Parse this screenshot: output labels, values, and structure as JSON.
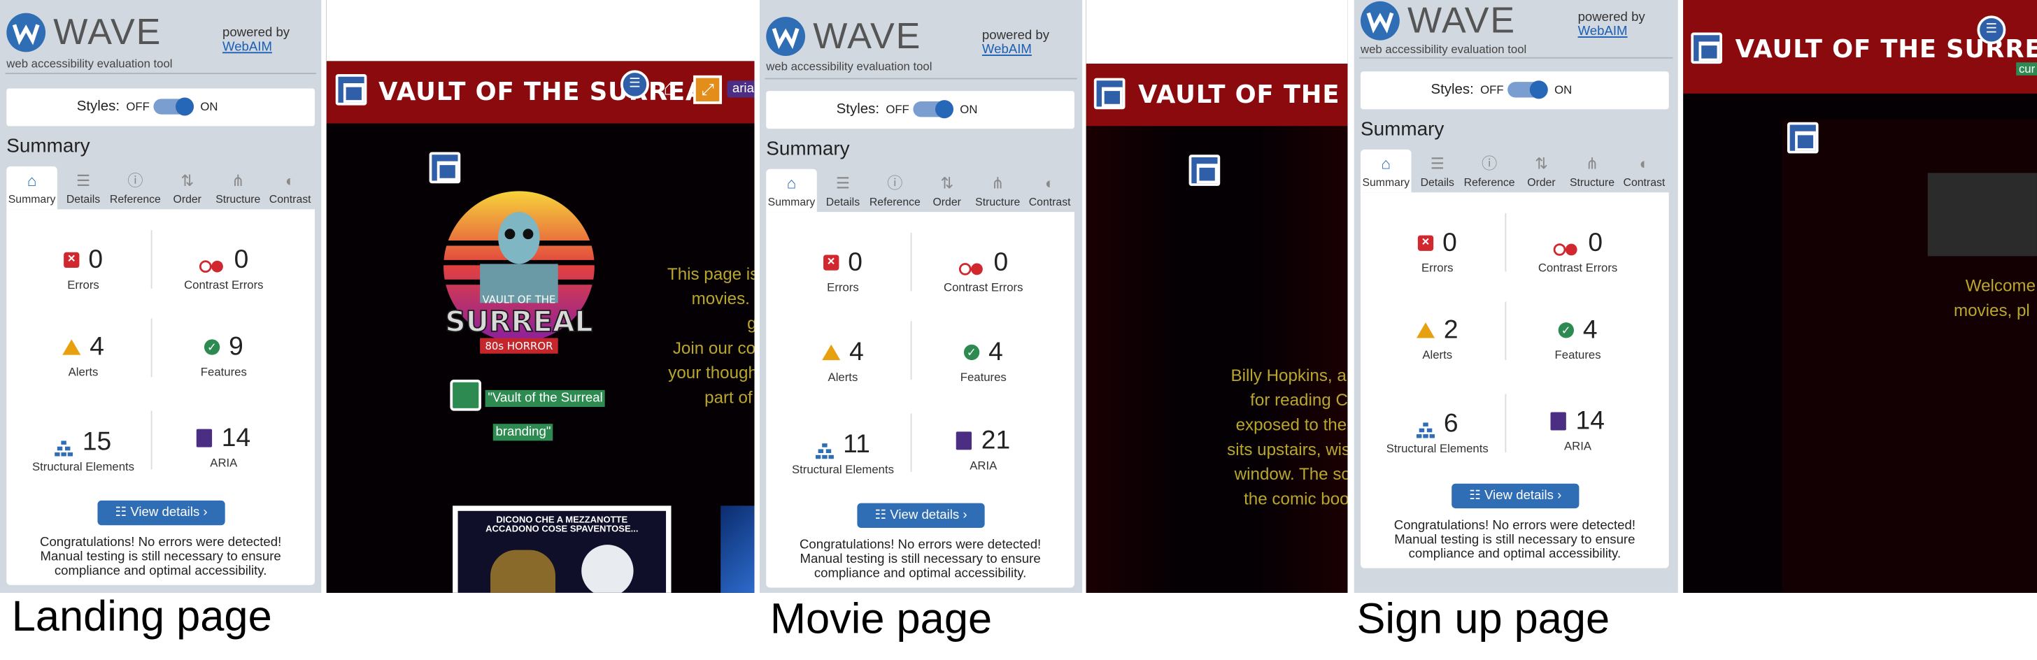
{
  "panels": [
    {
      "wave_wordmark": "WAVE",
      "tagline": "web accessibility evaluation tool",
      "powered_by": "powered by",
      "webaim_link": "WebAIM",
      "styles_label": "Styles:",
      "styles_off": "OFF",
      "styles_on": "ON",
      "summary_heading": "Summary",
      "tabs": [
        "Summary",
        "Details",
        "Reference",
        "Order",
        "Structure",
        "Contrast"
      ],
      "counts": {
        "errors": "0",
        "contrast_errors": "0",
        "alerts": "4",
        "features": "9",
        "structural": "15",
        "aria": "14"
      },
      "labels": {
        "errors": "Errors",
        "contrast_errors": "Contrast Errors",
        "alerts": "Alerts",
        "features": "Features",
        "structural": "Structural Elements",
        "aria": "ARIA"
      },
      "view_details": "View details ›",
      "congrats": "Congratulations! No errors were detected! Manual testing is still necessary to ensure compliance and optimal accessibility."
    },
    {
      "wave_wordmark": "WAVE",
      "tagline": "web accessibility evaluation tool",
      "powered_by": "powered by",
      "webaim_link": "WebAIM",
      "styles_label": "Styles:",
      "styles_off": "OFF",
      "styles_on": "ON",
      "summary_heading": "Summary",
      "tabs": [
        "Summary",
        "Details",
        "Reference",
        "Order",
        "Structure",
        "Contrast"
      ],
      "counts": {
        "errors": "0",
        "contrast_errors": "0",
        "alerts": "4",
        "features": "4",
        "structural": "11",
        "aria": "21"
      },
      "labels": {
        "errors": "Errors",
        "contrast_errors": "Contrast Errors",
        "alerts": "Alerts",
        "features": "Features",
        "structural": "Structural Elements",
        "aria": "ARIA"
      },
      "view_details": "View details ›",
      "congrats": "Congratulations! No errors were detected! Manual testing is still necessary to ensure compliance and optimal accessibility."
    },
    {
      "wave_wordmark": "WAVE",
      "tagline": "web accessibility evaluation tool",
      "powered_by": "powered by",
      "webaim_link": "WebAIM",
      "styles_label": "Styles:",
      "styles_off": "OFF",
      "styles_on": "ON",
      "summary_heading": "Summary",
      "tabs": [
        "Summary",
        "Details",
        "Reference",
        "Order",
        "Structure",
        "Contrast"
      ],
      "counts": {
        "errors": "0",
        "contrast_errors": "0",
        "alerts": "2",
        "features": "4",
        "structural": "6",
        "aria": "14"
      },
      "labels": {
        "errors": "Errors",
        "contrast_errors": "Contrast Errors",
        "alerts": "Alerts",
        "features": "Features",
        "structural": "Structural Elements",
        "aria": "ARIA"
      },
      "view_details": "View details ›",
      "congrats": "Congratulations! No errors were detected! Manual testing is still necessary to ensure compliance and optimal accessibility."
    }
  ],
  "site": {
    "title": "VAULT OF THE SURREAL",
    "title_partial_movie": "VAULT OF THE SURREA",
    "landing": {
      "text_lines": [
        "This page is",
        "movies.",
        "g",
        "Join our co",
        "your though",
        "part of"
      ],
      "alt_tag_1": "\"Vault of the Surreal",
      "alt_tag_2": "branding\"",
      "poster_caption_1": "DICONO CHE A MEZZANOTTE",
      "poster_caption_2": "ACCADONO COSE SPAVENTOSE...",
      "poster_logo_top": "VAULT OF THE",
      "poster_logo_main": "SURREAL",
      "poster_logo_sub": "80s HORROR",
      "aria_label": "aria"
    },
    "movie": {
      "text_lines": [
        "Billy Hopkins, a",
        "for reading C",
        "exposed to the",
        "sits upstairs, wis",
        "window. The so",
        "the comic boo"
      ]
    },
    "signup": {
      "text_lines": [
        "Welcome",
        "movies, pl"
      ],
      "cur_label": "cur"
    }
  },
  "captions": [
    "Landing page",
    "Movie page",
    "Sign up page"
  ],
  "colors": {
    "wave_blue": "#2f6eb5",
    "header_red": "#8b0a0e",
    "yellow_text": "#b9a62d",
    "error_red": "#d0282e",
    "alert_orange": "#e6a010",
    "feature_green": "#2d8b52",
    "aria_purple": "#4b2e83"
  }
}
